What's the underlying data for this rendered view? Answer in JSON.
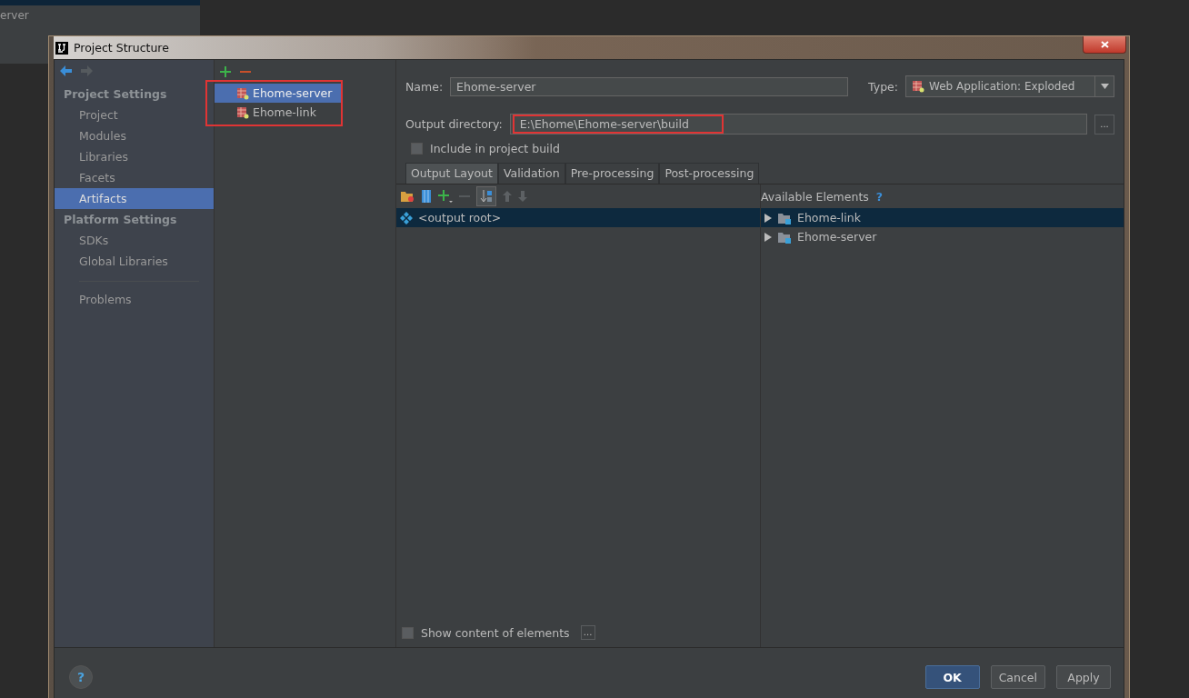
{
  "background_window": {
    "text": "erver"
  },
  "window": {
    "title": "Project Structure"
  },
  "sidebar": {
    "sections": [
      {
        "heading": "Project Settings",
        "items": [
          {
            "label": "Project",
            "selected": false
          },
          {
            "label": "Modules",
            "selected": false
          },
          {
            "label": "Libraries",
            "selected": false
          },
          {
            "label": "Facets",
            "selected": false
          },
          {
            "label": "Artifacts",
            "selected": true
          }
        ]
      },
      {
        "heading": "Platform Settings",
        "items": [
          {
            "label": "SDKs",
            "selected": false
          },
          {
            "label": "Global Libraries",
            "selected": false
          }
        ]
      }
    ],
    "footer_items": [
      {
        "label": "Problems",
        "selected": false
      }
    ]
  },
  "artifacts": {
    "highlighted": true,
    "items": [
      {
        "label": "Ehome-server",
        "selected": true
      },
      {
        "label": "Ehome-link",
        "selected": false
      }
    ]
  },
  "name": {
    "label": "Name:",
    "value": "Ehome-server"
  },
  "type": {
    "label": "Type:",
    "value": "Web Application: Exploded"
  },
  "output_directory": {
    "label": "Output directory:",
    "value": "E:\\Ehome\\Ehome-server\\build",
    "highlighted": true,
    "browse": "..."
  },
  "include_in_build": {
    "label": "Include in project build",
    "checked": false
  },
  "tabs": [
    {
      "label": "Output Layout",
      "selected": true
    },
    {
      "label": "Validation",
      "selected": false
    },
    {
      "label": "Pre-processing",
      "selected": false
    },
    {
      "label": "Post-processing",
      "selected": false
    }
  ],
  "layout_tree": [
    {
      "label": "<output root>",
      "selected": true
    }
  ],
  "available_elements": {
    "title": "Available Elements",
    "help": "?",
    "items": [
      {
        "label": "Ehome-link",
        "selected": true,
        "expanded": false
      },
      {
        "label": "Ehome-server",
        "selected": false,
        "expanded": false
      }
    ]
  },
  "show_content": {
    "label": "Show content of elements",
    "checked": false,
    "more": "..."
  },
  "help_button": "?",
  "buttons": [
    {
      "label": "OK",
      "kind": "default"
    },
    {
      "label": "Cancel",
      "kind": "normal"
    },
    {
      "label": "Apply",
      "kind": "normal"
    }
  ]
}
